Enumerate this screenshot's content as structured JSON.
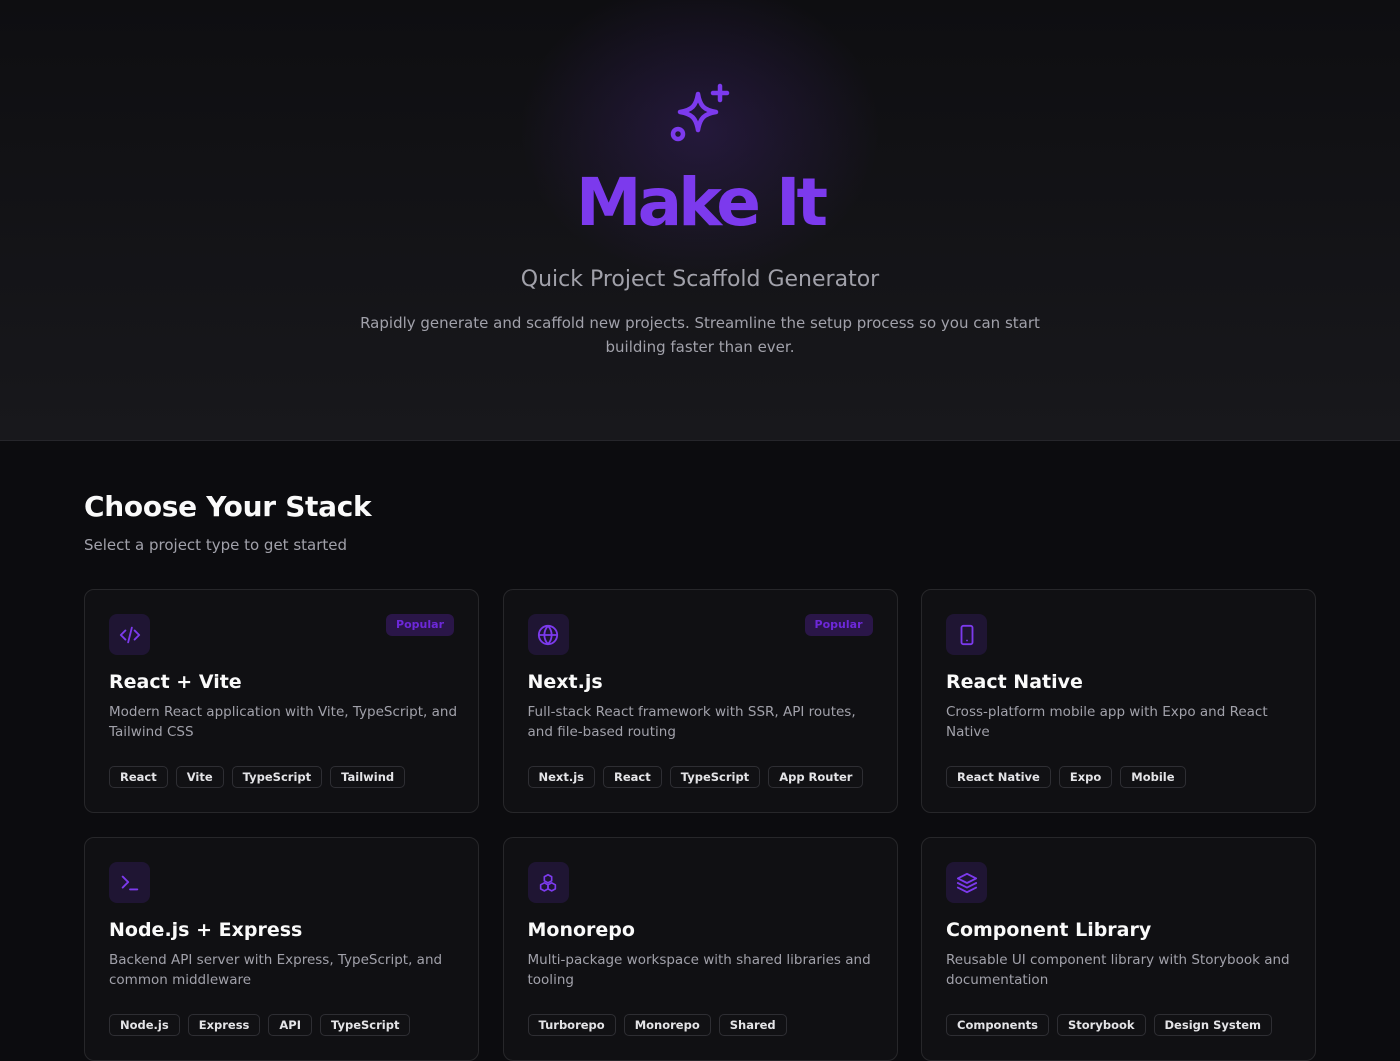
{
  "hero": {
    "title": "Make It",
    "subtitle": "Quick Project Scaffold Generator",
    "description": "Rapidly generate and scaffold new projects. Streamline the setup process so you can start building faster than ever.",
    "icon": "sparkles-icon"
  },
  "section": {
    "title": "Choose Your Stack",
    "subtitle": "Select a project type to get started"
  },
  "colors": {
    "accent": "#7c3aed",
    "background": "#0c0c0f",
    "card": "#101013"
  },
  "cards": [
    {
      "title": "React + Vite",
      "description": "Modern React application with Vite, TypeScript, and Tailwind CSS",
      "icon": "code-icon",
      "badge": "Popular",
      "tags": [
        "React",
        "Vite",
        "TypeScript",
        "Tailwind"
      ]
    },
    {
      "title": "Next.js",
      "description": "Full-stack React framework with SSR, API routes, and file-based routing",
      "icon": "globe-icon",
      "badge": "Popular",
      "tags": [
        "Next.js",
        "React",
        "TypeScript",
        "App Router"
      ]
    },
    {
      "title": "React Native",
      "description": "Cross-platform mobile app with Expo and React Native",
      "icon": "smartphone-icon",
      "tags": [
        "React Native",
        "Expo",
        "Mobile"
      ]
    },
    {
      "title": "Node.js + Express",
      "description": "Backend API server with Express, TypeScript, and common middleware",
      "icon": "terminal-icon",
      "tags": [
        "Node.js",
        "Express",
        "API",
        "TypeScript"
      ]
    },
    {
      "title": "Monorepo",
      "description": "Multi-package workspace with shared libraries and tooling",
      "icon": "boxes-icon",
      "tags": [
        "Turborepo",
        "Monorepo",
        "Shared"
      ]
    },
    {
      "title": "Component Library",
      "description": "Reusable UI component library with Storybook and documentation",
      "icon": "layers-icon",
      "tags": [
        "Components",
        "Storybook",
        "Design System"
      ]
    }
  ]
}
